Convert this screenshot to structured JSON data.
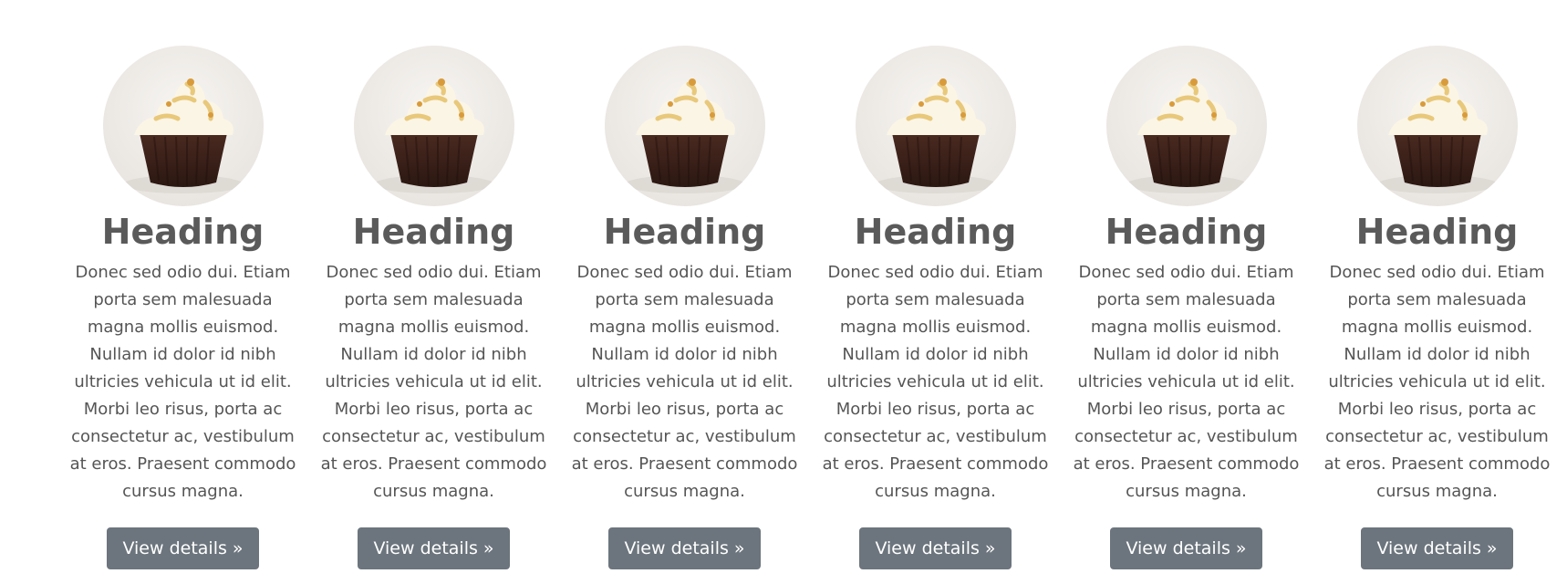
{
  "columns": [
    {
      "heading": "Heading",
      "text": "Donec sed odio dui. Etiam porta sem malesuada magna mollis euismod. Nullam id dolor id nibh ultricies vehicula ut id elit. Morbi leo risus, porta ac consectetur ac, vestibulum at eros. Praesent commodo cursus magna.",
      "button": "View details »",
      "image_icon": "cupcake-icon"
    },
    {
      "heading": "Heading",
      "text": "Donec sed odio dui. Etiam porta sem malesuada magna mollis euismod. Nullam id dolor id nibh ultricies vehicula ut id elit. Morbi leo risus, porta ac consectetur ac, vestibulum at eros. Praesent commodo cursus magna.",
      "button": "View details »",
      "image_icon": "cupcake-icon"
    },
    {
      "heading": "Heading",
      "text": "Donec sed odio dui. Etiam porta sem malesuada magna mollis euismod. Nullam id dolor id nibh ultricies vehicula ut id elit. Morbi leo risus, porta ac consectetur ac, vestibulum at eros. Praesent commodo cursus magna.",
      "button": "View details »",
      "image_icon": "cupcake-icon"
    },
    {
      "heading": "Heading",
      "text": "Donec sed odio dui. Etiam porta sem malesuada magna mollis euismod. Nullam id dolor id nibh ultricies vehicula ut id elit. Morbi leo risus, porta ac consectetur ac, vestibulum at eros. Praesent commodo cursus magna.",
      "button": "View details »",
      "image_icon": "cupcake-icon"
    },
    {
      "heading": "Heading",
      "text": "Donec sed odio dui. Etiam porta sem malesuada magna mollis euismod. Nullam id dolor id nibh ultricies vehicula ut id elit. Morbi leo risus, porta ac consectetur ac, vestibulum at eros. Praesent commodo cursus magna.",
      "button": "View details »",
      "image_icon": "cupcake-icon"
    },
    {
      "heading": "Heading",
      "text": "Donec sed odio dui. Etiam porta sem malesuada magna mollis euismod. Nullam id dolor id nibh ultricies vehicula ut id elit. Morbi leo risus, porta ac consectetur ac, vestibulum at eros. Praesent commodo cursus magna.",
      "button": "View details »",
      "image_icon": "cupcake-icon"
    }
  ],
  "colors": {
    "button_bg": "#6c757d",
    "button_text": "#ffffff",
    "heading": "#5a5a5a",
    "text": "#555555"
  }
}
